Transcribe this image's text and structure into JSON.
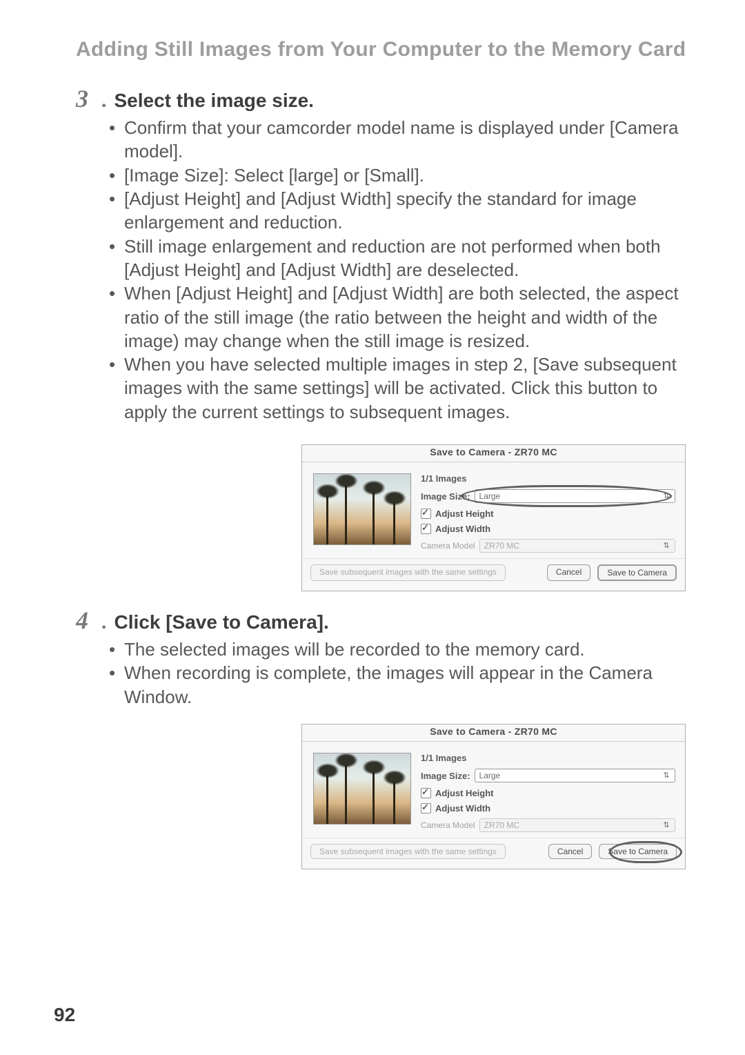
{
  "section_title": "Adding Still Images from Your Computer to the Memory Card",
  "page_number": "92",
  "step3": {
    "number": "3",
    "dot": ".",
    "title": "Select the image size.",
    "bullets": [
      "Confirm that your camcorder model name is displayed under [Camera model].",
      "[Image Size]: Select [large] or [Small].",
      "[Adjust Height] and [Adjust Width] specify the standard for image enlargement and reduction.",
      "Still image enlargement and reduction are not performed when both [Adjust Height] and [Adjust Width] are deselected.",
      "When [Adjust Height] and [Adjust Width] are both selected, the aspect ratio of the still image (the ratio between the height and width of  the image) may change when the still image is resized.",
      "When you have selected multiple images in step 2, [Save subsequent images with the same settings] will be activated. Click this button to apply the current settings to subsequent images."
    ]
  },
  "step4": {
    "number": "4",
    "dot": ".",
    "title": "Click [Save to Camera].",
    "bullets": [
      "The selected images will be recorded to the memory card.",
      "When recording is complete, the images will appear in the Camera Window."
    ]
  },
  "dialog1": {
    "title": "Save to Camera - ZR70 MC",
    "counter": "1/1 Images",
    "image_size_label": "Image Size:",
    "image_size_value": "Large",
    "adjust_height": "Adjust Height",
    "adjust_width": "Adjust Width",
    "camera_model_label": "Camera Model",
    "camera_model_value": "ZR70 MC",
    "btn_subsequent": "Save subsequent images with the same settings",
    "btn_cancel": "Cancel",
    "btn_save": "Save to Camera"
  },
  "dialog2": {
    "title": "Save to Camera - ZR70 MC",
    "counter": "1/1 Images",
    "image_size_label": "Image Size:",
    "image_size_value": "Large",
    "adjust_height": "Adjust Height",
    "adjust_width": "Adjust Width",
    "camera_model_label": "Camera Model",
    "camera_model_value": "ZR70 MC",
    "btn_subsequent": "Save subsequent images with the same settings",
    "btn_cancel": "Cancel",
    "btn_save": "Save to Camera"
  }
}
